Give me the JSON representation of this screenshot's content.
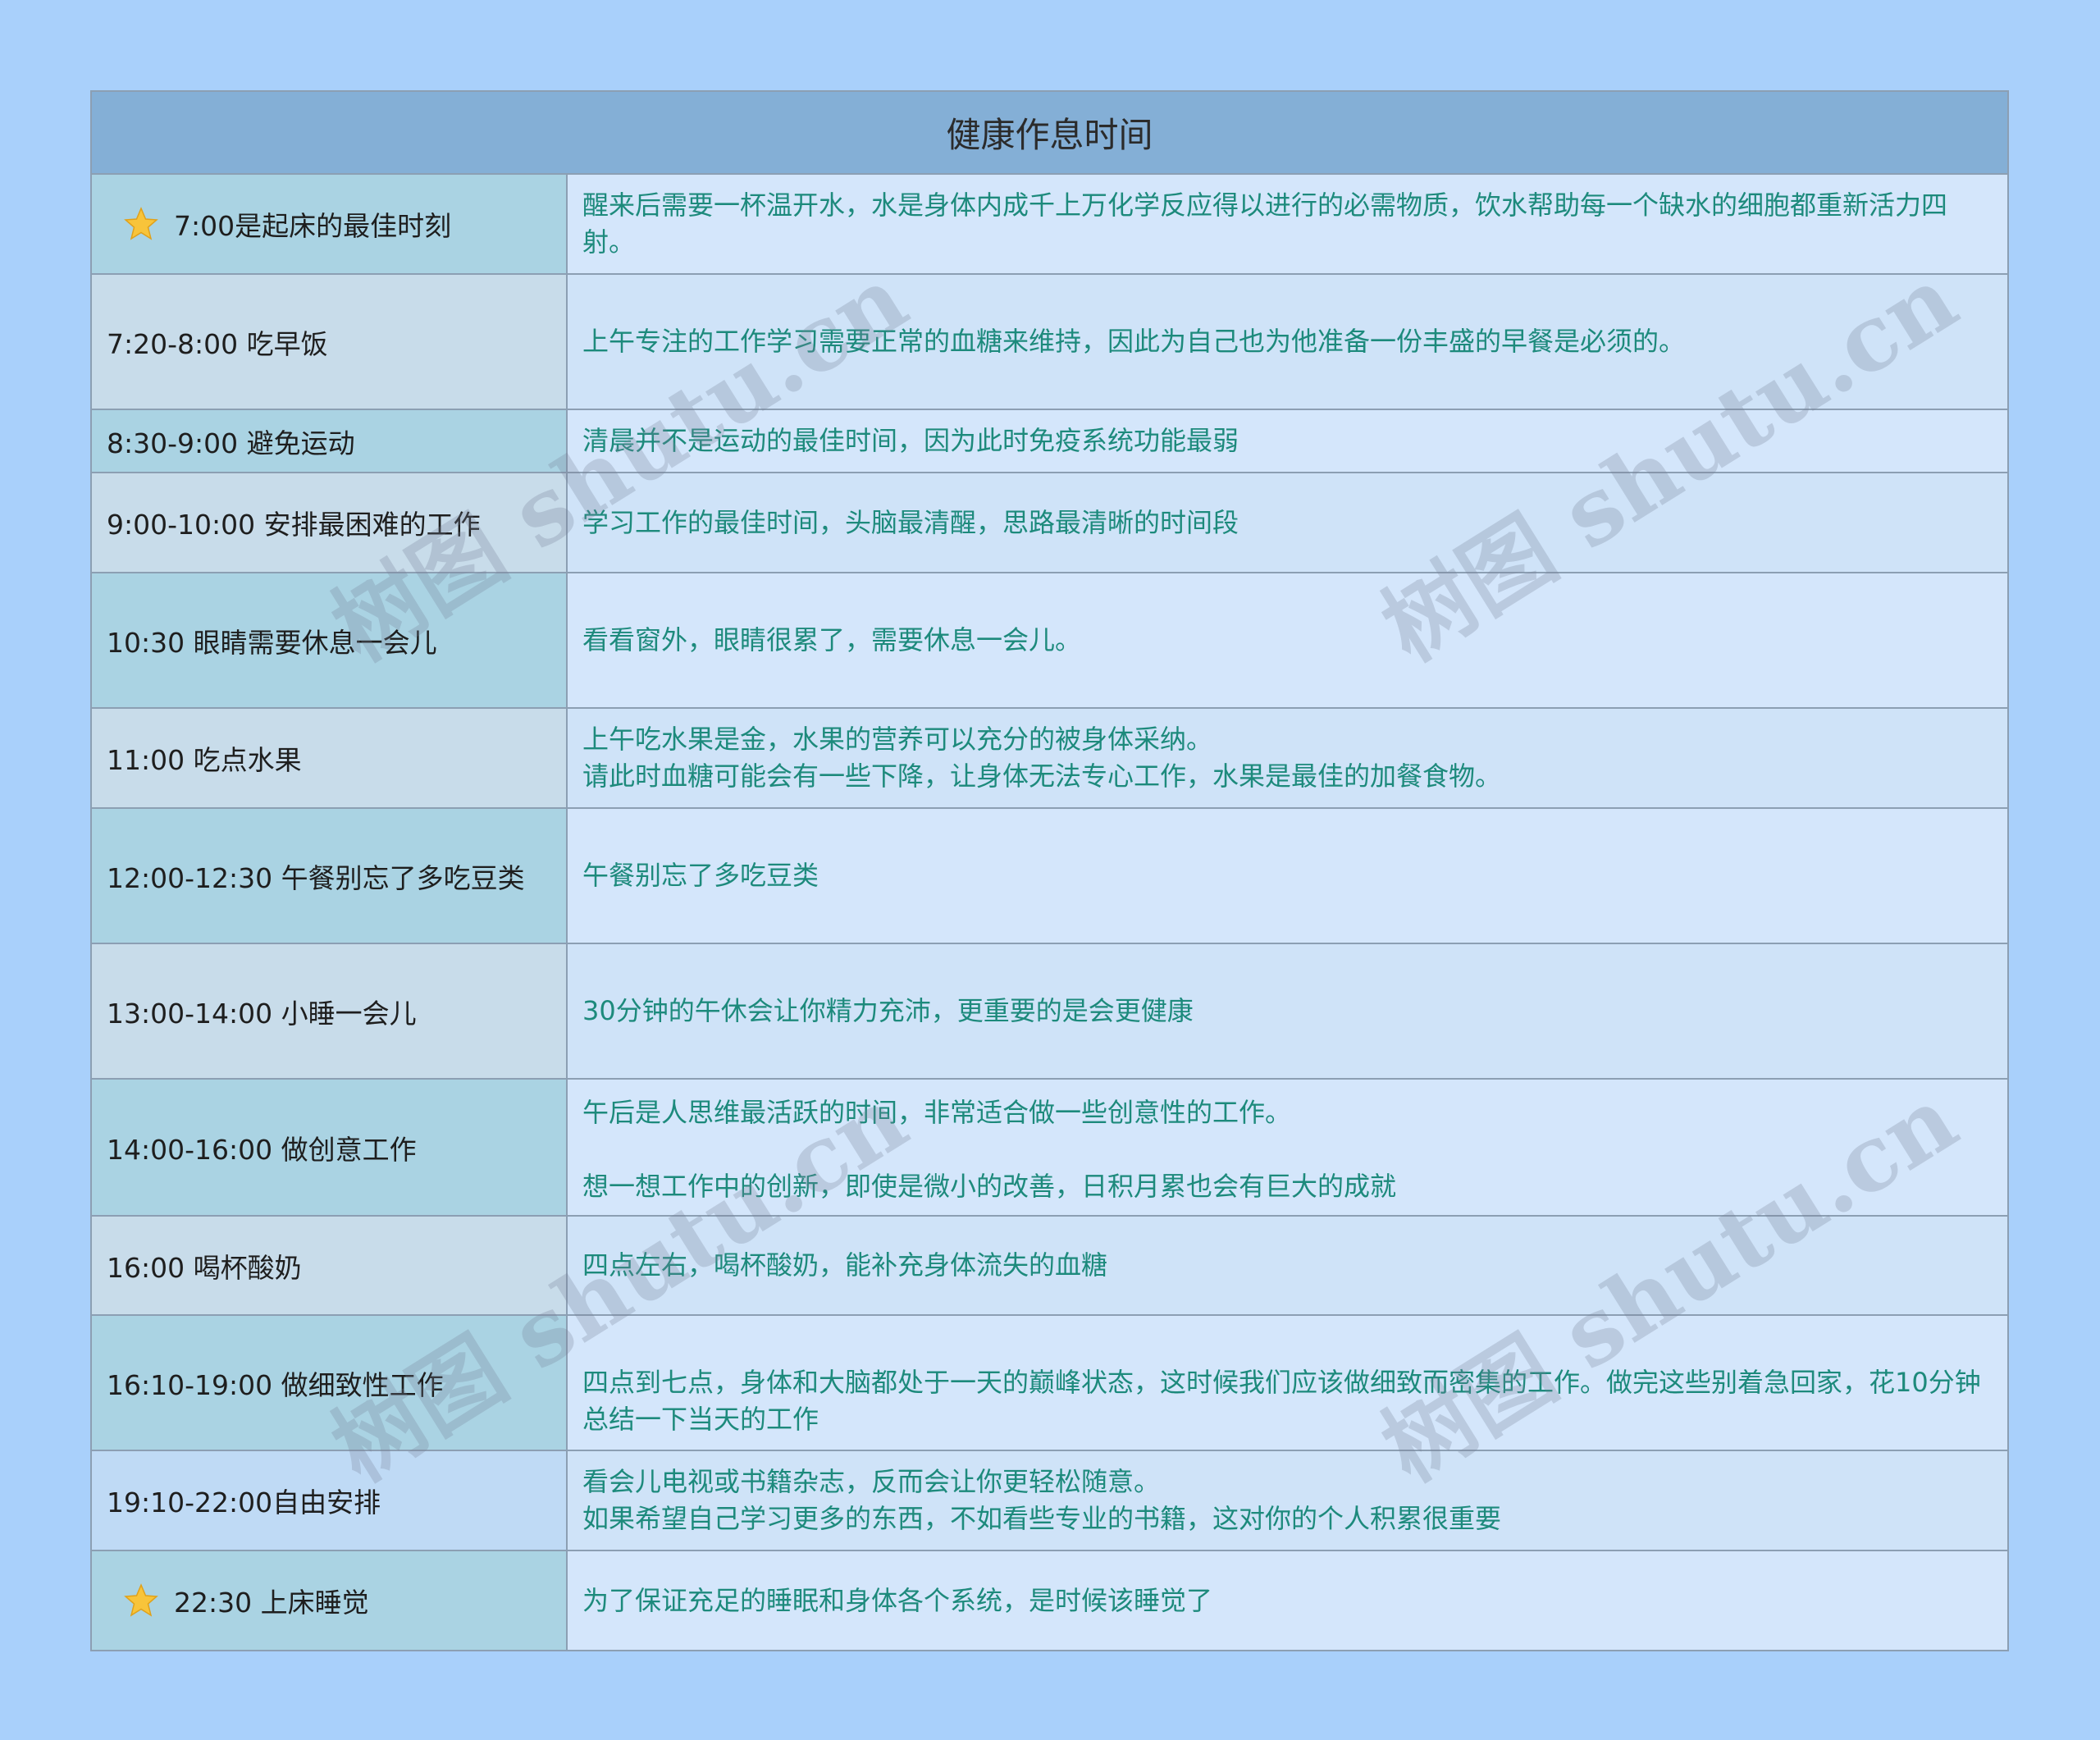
{
  "title": "健康作息时间",
  "rows": [
    {
      "time": "7:00是起床的最佳时刻",
      "desc": "醒来后需要一杯温开水，水是身体内成千上万化学反应得以进行的必需物质，饮水帮助每一个缺水的细胞都重新活力四射。",
      "star": true
    },
    {
      "time": "7:20-8:00 吃早饭",
      "desc": "上午专注的工作学习需要正常的血糖来维持，因此为自己也为他准备一份丰盛的早餐是必须的。"
    },
    {
      "time": "8:30-9:00 避免运动",
      "desc": "清晨并不是运动的最佳时间，因为此时免疫系统功能最弱"
    },
    {
      "time": "9:00-10:00 安排最困难的工作",
      "desc": "学习工作的最佳时间，头脑最清醒，思路最清晰的时间段"
    },
    {
      "time": "10:30 眼睛需要休息一会儿",
      "desc": "看看窗外，眼睛很累了，需要休息一会儿。"
    },
    {
      "time": "11:00 吃点水果",
      "desc": "上午吃水果是金，水果的营养可以充分的被身体采纳。\n请此时血糖可能会有一些下降，让身体无法专心工作，水果是最佳的加餐食物。"
    },
    {
      "time": "12:00-12:30 午餐别忘了多吃豆类",
      "desc": "午餐别忘了多吃豆类"
    },
    {
      "time": "13:00-14:00 小睡一会儿",
      "desc": "30分钟的午休会让你精力充沛，更重要的是会更健康"
    },
    {
      "time": "14:00-16:00 做创意工作",
      "desc": "午后是人思维最活跃的时间，非常适合做一些创意性的工作。\n\n想一想工作中的创新，即使是微小的改善，日积月累也会有巨大的成就"
    },
    {
      "time": "16:00 喝杯酸奶",
      "desc": "四点左右，喝杯酸奶，能补充身体流失的血糖"
    },
    {
      "time": "16:10-19:00 做细致性工作",
      "desc": "四点到七点，身体和大脑都处于一天的巅峰状态，这时候我们应该做细致而密集的工作。做完这些别着急回家，花10分钟总结一下当天的工作"
    },
    {
      "time": "19:10-22:00自由安排",
      "desc": "看会儿电视或书籍杂志，反而会让你更轻松随意。\n如果希望自己学习更多的东西，不如看些专业的书籍，这对你的个人积累很重要"
    },
    {
      "time": "22:30 上床睡觉",
      "desc": "为了保证充足的睡眠和身体各个系统，是时候该睡觉了",
      "star": true
    }
  ],
  "watermark": "树图 shutu.cn",
  "icons": {
    "star": "star-icon"
  },
  "colors": {
    "background": "#a9d0fb",
    "header": "#84afd6",
    "desc_text": "#1d8a7c"
  }
}
